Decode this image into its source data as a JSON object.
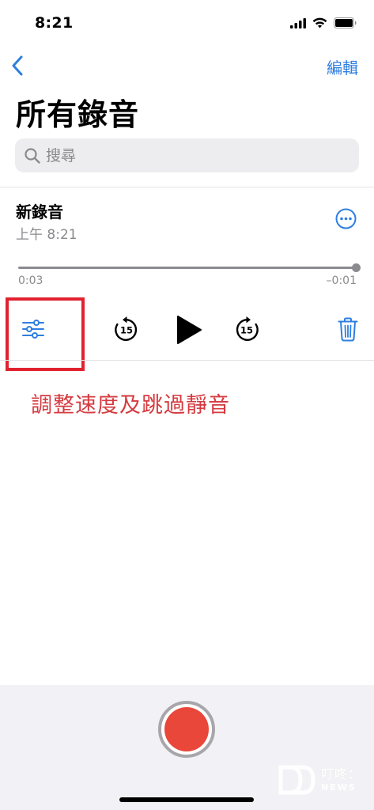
{
  "status_bar": {
    "time": "8:21"
  },
  "nav": {
    "edit_label": "編輯"
  },
  "page": {
    "title": "所有錄音"
  },
  "search": {
    "placeholder": "搜尋"
  },
  "recording": {
    "title": "新錄音",
    "subtitle": "上午 8:21",
    "elapsed": "0:03",
    "remaining": "–0:01",
    "progress": 1.0,
    "skip_back_label": "15",
    "skip_forward_label": "15"
  },
  "annotation": {
    "text": "調整速度及跳過靜音"
  },
  "watermark": {
    "brand": "叮咚：",
    "sub": "NEWS"
  },
  "icons": {
    "back": "chevron-left-icon",
    "search": "search-icon",
    "more": "ellipsis-circle-icon",
    "settings": "sliders-icon",
    "skip_back": "gobackward-15-icon",
    "play": "play-icon",
    "skip_forward": "goforward-15-icon",
    "trash": "trash-icon",
    "record": "record-icon"
  },
  "colors": {
    "accent": "#2f7ee0",
    "record": "#e8473a",
    "annotation": "#d53a3f",
    "highlight": "#e0222f"
  }
}
